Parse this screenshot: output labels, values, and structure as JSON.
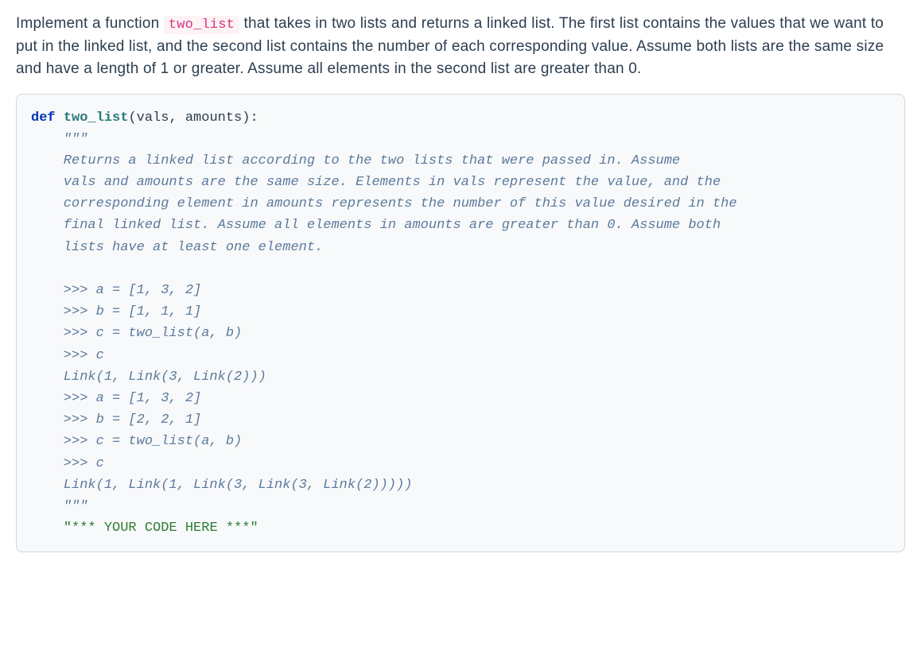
{
  "description": {
    "part1": "Implement a function ",
    "codeToken": "two_list",
    "part2": " that takes in two lists and returns a linked list. The first list contains the values that we want to put in the linked list, and the second list contains the number of each corresponding value. Assume both lists are the same size and have a length of 1 or greater. Assume all elements in the second list are greater than 0."
  },
  "code": {
    "defKw": "def",
    "funcName": "two_list",
    "signatureTail": "(vals, amounts):",
    "tripleQuoteOpen": "    \"\"\"",
    "doc1": "    Returns a linked list according to the two lists that were passed in. Assume",
    "doc2": "    vals and amounts are the same size. Elements in vals represent the value, and the",
    "doc3": "    corresponding element in amounts represents the number of this value desired in the",
    "doc4": "    final linked list. Assume all elements in amounts are greater than 0. Assume both",
    "doc5": "    lists have at least one element.",
    "blank": "",
    "ex1": "    >>> a = [1, 3, 2]",
    "ex2": "    >>> b = [1, 1, 1]",
    "ex3": "    >>> c = two_list(a, b)",
    "ex4": "    >>> c",
    "ex5": "    Link(1, Link(3, Link(2)))",
    "ex6": "    >>> a = [1, 3, 2]",
    "ex7": "    >>> b = [2, 2, 1]",
    "ex8": "    >>> c = two_list(a, b)",
    "ex9": "    >>> c",
    "ex10": "    Link(1, Link(1, Link(3, Link(3, Link(2)))))",
    "tripleQuoteClose": "    \"\"\"",
    "placeholderIndent": "    ",
    "placeholder": "\"*** YOUR CODE HERE ***\""
  }
}
